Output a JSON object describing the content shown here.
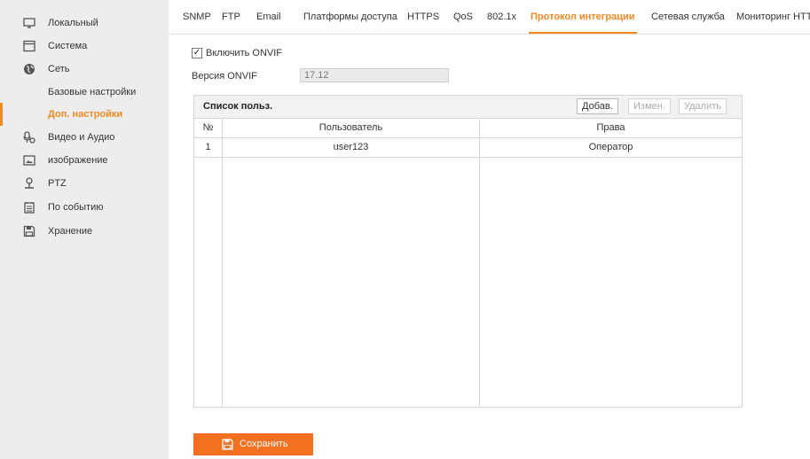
{
  "sidebar": {
    "items": [
      {
        "label": "Локальный",
        "icon": "monitor-icon"
      },
      {
        "label": "Система",
        "icon": "system-icon"
      },
      {
        "label": "Сеть",
        "icon": "globe-icon"
      },
      {
        "label": "Базовые настройки",
        "icon": ""
      },
      {
        "label": "Доп. настройки",
        "icon": ""
      },
      {
        "label": "Видео и Аудио",
        "icon": "video-audio-icon"
      },
      {
        "label": "изображение",
        "icon": "image-icon"
      },
      {
        "label": "PTZ",
        "icon": "ptz-icon"
      },
      {
        "label": "По событию",
        "icon": "event-icon"
      },
      {
        "label": "Хранение",
        "icon": "storage-icon"
      }
    ]
  },
  "tabs": [
    {
      "label": "SNMP"
    },
    {
      "label": "FTP"
    },
    {
      "label": "Email"
    },
    {
      "label": "Платформы доступа"
    },
    {
      "label": "HTTPS"
    },
    {
      "label": "QoS"
    },
    {
      "label": "802.1x"
    },
    {
      "label": "Протокол интеграции"
    },
    {
      "label": "Сетевая служба"
    },
    {
      "label": "Мониторинг HTTP"
    }
  ],
  "onvif": {
    "enable_label": "Включить ONVIF",
    "enabled_mark": "✓",
    "version_label": "Версия ONVIF",
    "version_value": "17.12"
  },
  "user_list": {
    "title": "Список польз.",
    "add_label": "Добав.",
    "edit_label": "Измен.",
    "delete_label": "Удалить",
    "columns": [
      "№",
      "Пользователь",
      "Права"
    ],
    "rows": [
      {
        "no": "1",
        "user": "user123",
        "rights": "Оператор"
      }
    ]
  },
  "save_label": "Сохранить",
  "colors": {
    "accent": "#f08a24",
    "save_bg": "#f37021",
    "sidebar_bg": "#ededed"
  }
}
